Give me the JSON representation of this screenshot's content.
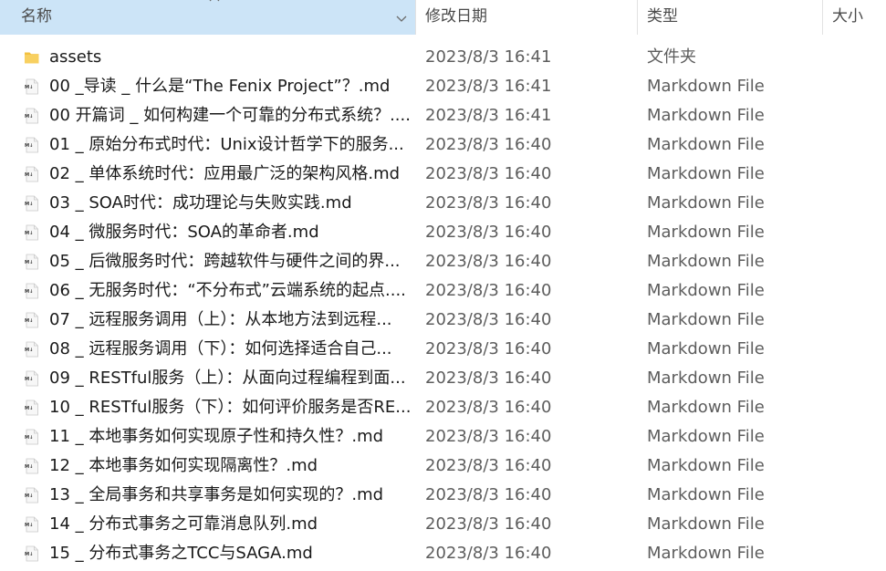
{
  "header": {
    "name_label": "名称",
    "date_label": "修改日期",
    "type_label": "类型",
    "size_label": "大小",
    "sort_icon": "sort-up-icon",
    "dropdown_icon": "chevron-down-icon"
  },
  "colors": {
    "header_selected": "#cce4f7",
    "folder": "#f3c13f",
    "text_primary": "#1a1a1a",
    "text_secondary": "#5d5d5d"
  },
  "files": [
    {
      "icon": "folder-icon",
      "name": "assets",
      "date": "2023/8/3 16:41",
      "type": "文件夹"
    },
    {
      "icon": "markdown-file-icon",
      "name": "00 _导读 _ 什么是“The Fenix Project”？.md",
      "date": "2023/8/3 16:41",
      "type": "Markdown File"
    },
    {
      "icon": "markdown-file-icon",
      "name": "00 开篇词 _ 如何构建一个可靠的分布式系统？....",
      "date": "2023/8/3 16:41",
      "type": "Markdown File"
    },
    {
      "icon": "markdown-file-icon",
      "name": "01 _ 原始分布式时代：Unix设计哲学下的服务...",
      "date": "2023/8/3 16:40",
      "type": "Markdown File"
    },
    {
      "icon": "markdown-file-icon",
      "name": "02 _ 单体系统时代：应用最广泛的架构风格.md",
      "date": "2023/8/3 16:40",
      "type": "Markdown File"
    },
    {
      "icon": "markdown-file-icon",
      "name": "03 _ SOA时代：成功理论与失败实践.md",
      "date": "2023/8/3 16:40",
      "type": "Markdown File"
    },
    {
      "icon": "markdown-file-icon",
      "name": "04 _ 微服务时代：SOA的革命者.md",
      "date": "2023/8/3 16:40",
      "type": "Markdown File"
    },
    {
      "icon": "markdown-file-icon",
      "name": "05 _ 后微服务时代：跨越软件与硬件之间的界...",
      "date": "2023/8/3 16:40",
      "type": "Markdown File"
    },
    {
      "icon": "markdown-file-icon",
      "name": "06 _ 无服务时代：“不分布式”云端系统的起点....",
      "date": "2023/8/3 16:40",
      "type": "Markdown File"
    },
    {
      "icon": "markdown-file-icon",
      "name": "07 _ 远程服务调用（上）：从本地方法到远程...",
      "date": "2023/8/3 16:40",
      "type": "Markdown File"
    },
    {
      "icon": "markdown-file-icon",
      "name": "08 _ 远程服务调用（下）：如何选择适合自己...",
      "date": "2023/8/3 16:40",
      "type": "Markdown File"
    },
    {
      "icon": "markdown-file-icon",
      "name": "09 _ RESTful服务（上）：从面向过程编程到面...",
      "date": "2023/8/3 16:40",
      "type": "Markdown File"
    },
    {
      "icon": "markdown-file-icon",
      "name": "10 _ RESTful服务（下）：如何评价服务是否RE...",
      "date": "2023/8/3 16:40",
      "type": "Markdown File"
    },
    {
      "icon": "markdown-file-icon",
      "name": "11 _ 本地事务如何实现原子性和持久性？.md",
      "date": "2023/8/3 16:40",
      "type": "Markdown File"
    },
    {
      "icon": "markdown-file-icon",
      "name": "12 _ 本地事务如何实现隔离性？.md",
      "date": "2023/8/3 16:40",
      "type": "Markdown File"
    },
    {
      "icon": "markdown-file-icon",
      "name": "13 _ 全局事务和共享事务是如何实现的？.md",
      "date": "2023/8/3 16:40",
      "type": "Markdown File"
    },
    {
      "icon": "markdown-file-icon",
      "name": "14 _ 分布式事务之可靠消息队列.md",
      "date": "2023/8/3 16:40",
      "type": "Markdown File"
    },
    {
      "icon": "markdown-file-icon",
      "name": "15 _ 分布式事务之TCC与SAGA.md",
      "date": "2023/8/3 16:40",
      "type": "Markdown File"
    }
  ]
}
